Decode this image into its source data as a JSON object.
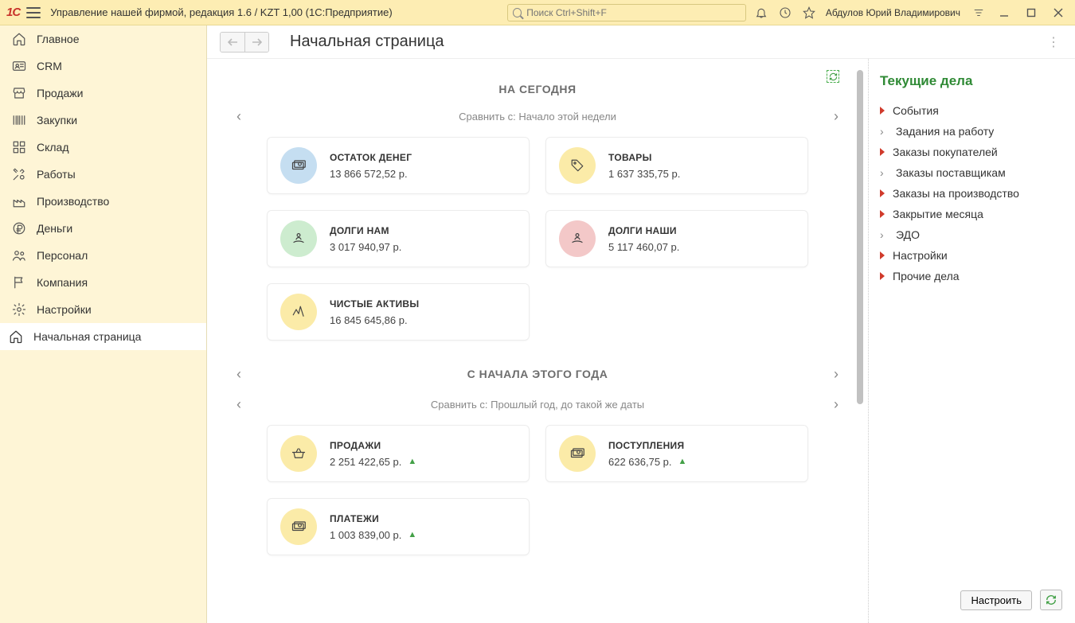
{
  "titlebar": {
    "app_title": "Управление нашей фирмой, редакция 1.6 / KZT 1,00  (1С:Предприятие)",
    "search_placeholder": "Поиск Ctrl+Shift+F",
    "user": "Абдулов Юрий Владимирович"
  },
  "sidebar": {
    "items": [
      {
        "label": "Главное",
        "icon": "home"
      },
      {
        "label": "CRM",
        "icon": "id-card"
      },
      {
        "label": "Продажи",
        "icon": "store"
      },
      {
        "label": "Закупки",
        "icon": "barcode"
      },
      {
        "label": "Склад",
        "icon": "grid"
      },
      {
        "label": "Работы",
        "icon": "tools"
      },
      {
        "label": "Производство",
        "icon": "factory"
      },
      {
        "label": "Деньги",
        "icon": "ruble"
      },
      {
        "label": "Персонал",
        "icon": "people"
      },
      {
        "label": "Компания",
        "icon": "flag"
      },
      {
        "label": "Настройки",
        "icon": "gear"
      }
    ],
    "active": {
      "label": "Начальная страница",
      "icon": "home-fill"
    }
  },
  "workspace": {
    "title": "Начальная страница"
  },
  "dashboard": {
    "sections": [
      {
        "heading": "НА СЕГОДНЯ",
        "compare": "Сравнить с: Начало этой недели",
        "cards": [
          {
            "title": "ОСТАТОК ДЕНЕГ",
            "value": "13 866 572,52 р.",
            "bg": "bg-blue",
            "icon": "cash"
          },
          {
            "title": "ТОВАРЫ",
            "value": "1 637 335,75 р.",
            "bg": "bg-yellow",
            "icon": "tag"
          },
          {
            "title": "ДОЛГИ НАМ",
            "value": "3 017 940,97 р.",
            "bg": "bg-green",
            "icon": "hand-person"
          },
          {
            "title": "ДОЛГИ НАШИ",
            "value": "5 117 460,07 р.",
            "bg": "bg-red",
            "icon": "hand-person"
          },
          {
            "title": "ЧИСТЫЕ АКТИВЫ",
            "value": "16 845 645,86 р.",
            "bg": "bg-yellow",
            "icon": "pulse"
          }
        ]
      },
      {
        "heading": "С НАЧАЛА ЭТОГО ГОДА",
        "compare": "Сравнить с: Прошлый год, до такой же даты",
        "cards": [
          {
            "title": "ПРОДАЖИ",
            "value": "2 251 422,65 р.",
            "bg": "bg-yellow",
            "icon": "basket",
            "trend": "up"
          },
          {
            "title": "ПОСТУПЛЕНИЯ",
            "value": "622 636,75 р.",
            "bg": "bg-yellow",
            "icon": "cash",
            "trend": "up"
          },
          {
            "title": "ПЛАТЕЖИ",
            "value": "1 003 839,00 р.",
            "bg": "bg-yellow",
            "icon": "cash",
            "trend": "up"
          }
        ]
      }
    ]
  },
  "right_panel": {
    "heading": "Текущие дела",
    "items": [
      {
        "label": "События",
        "marker": "red"
      },
      {
        "label": "Задания на работу",
        "marker": "chev"
      },
      {
        "label": "Заказы покупателей",
        "marker": "red"
      },
      {
        "label": "Заказы поставщикам",
        "marker": "chev"
      },
      {
        "label": "Заказы на производство",
        "marker": "red"
      },
      {
        "label": "Закрытие месяца",
        "marker": "red"
      },
      {
        "label": "ЭДО",
        "marker": "chev"
      },
      {
        "label": "Настройки",
        "marker": "red"
      },
      {
        "label": "Прочие дела",
        "marker": "red"
      }
    ],
    "configure_label": "Настроить"
  }
}
